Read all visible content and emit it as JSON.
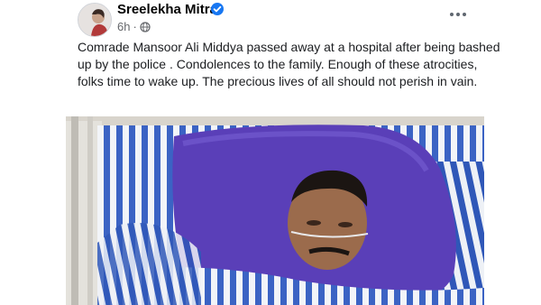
{
  "post": {
    "author": "Sreelekha Mitra",
    "time": "6h",
    "audience_icon": "globe-icon",
    "verified_icon": "verified-badge-icon",
    "menu_icon": "more-options-icon",
    "text": "Comrade Mansoor Ali Middya passed away at a hospital after being bashed up by the police . Condolences to the family. Enough of these atrocities, folks time to wake up. The precious lives of all should not perish in vain."
  },
  "colors": {
    "accent": "#1877f2",
    "name": "#050505",
    "meta": "#65676b",
    "text": "#1c1e21"
  }
}
